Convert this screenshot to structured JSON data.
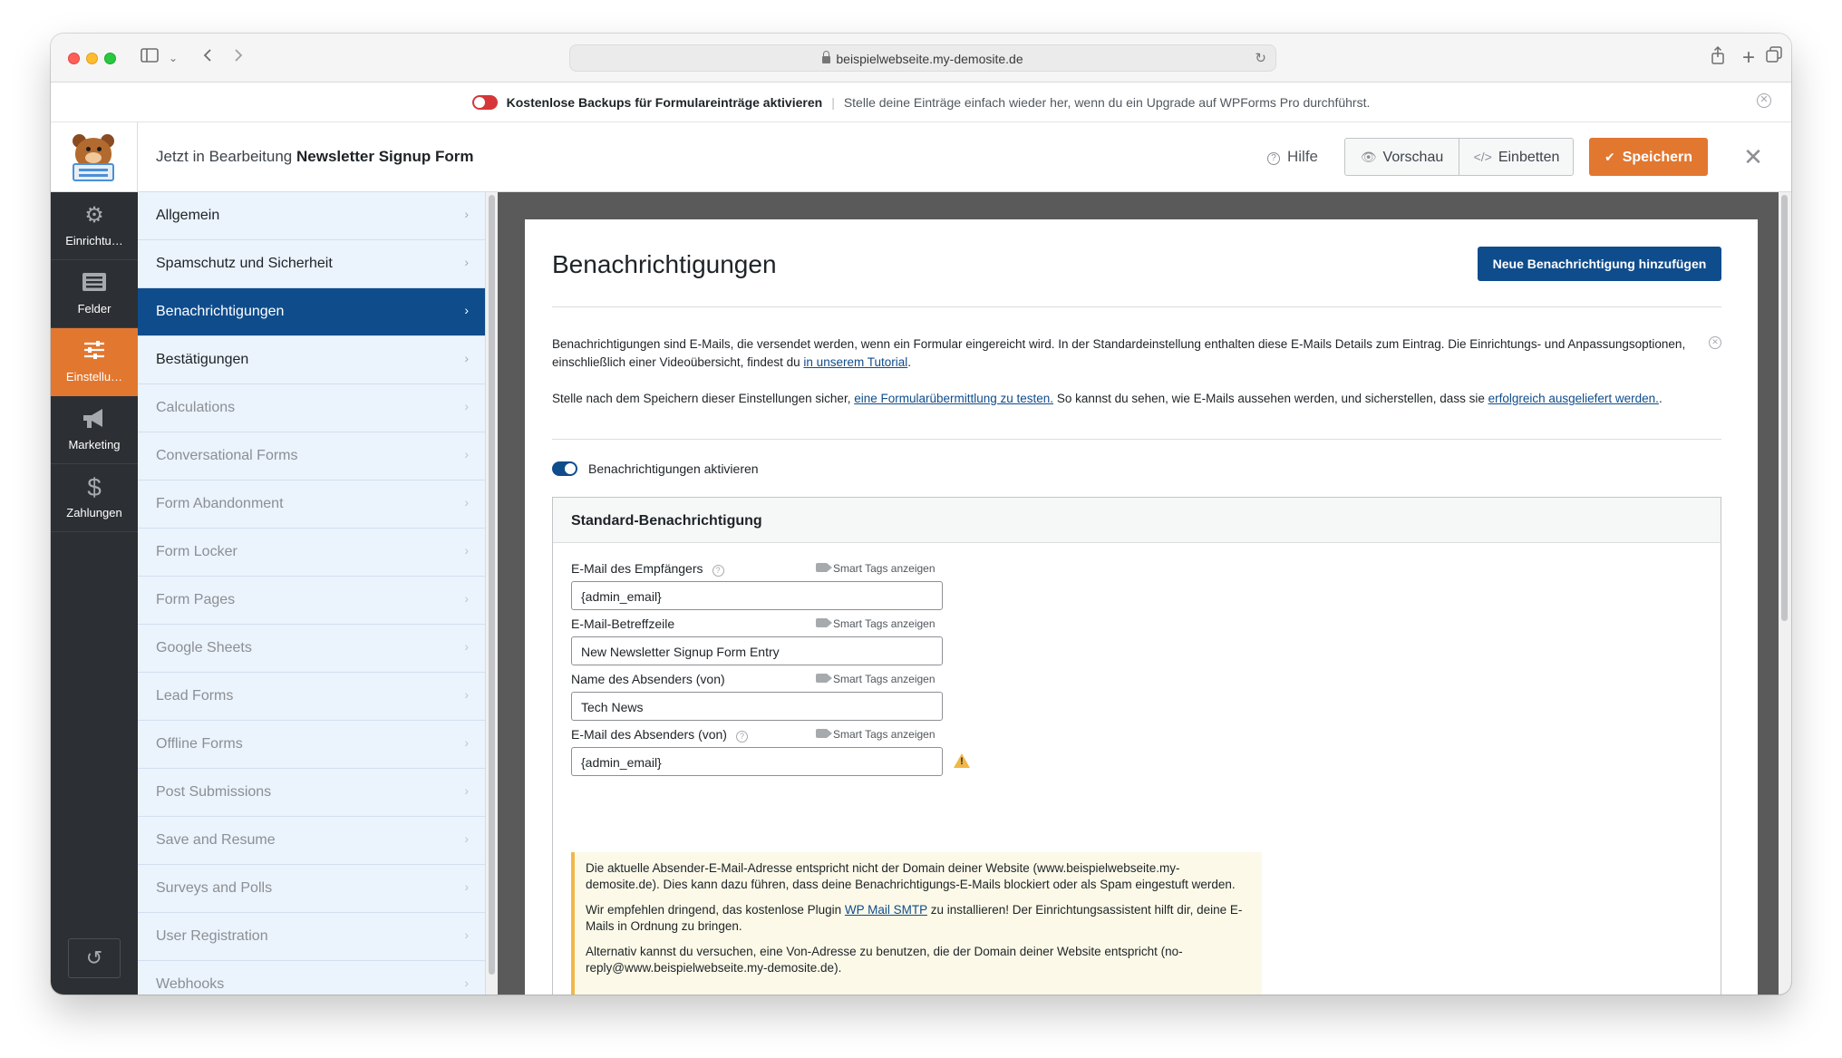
{
  "browser": {
    "url": "beispielwebseite.my-demosite.de"
  },
  "notice": {
    "strong": "Kostenlose Backups für Formulareinträge aktivieren",
    "separator": "|",
    "text": "Stelle deine Einträge einfach wieder her, wenn du ein Upgrade auf WPForms Pro durchführst."
  },
  "header": {
    "editing_prefix": "Jetzt in Bearbeitung",
    "form_name": "Newsletter Signup Form",
    "help_label": "Hilfe",
    "preview_label": "Vorschau",
    "embed_label": "Einbetten",
    "save_label": "Speichern"
  },
  "leftnav": [
    {
      "label": "Einrichtu…",
      "icon": "gear-icon"
    },
    {
      "label": "Felder",
      "icon": "fields-icon"
    },
    {
      "label": "Einstellu…",
      "icon": "sliders-icon",
      "active": true
    },
    {
      "label": "Marketing",
      "icon": "megaphone-icon"
    },
    {
      "label": "Zahlungen",
      "icon": "dollar-icon"
    }
  ],
  "settings_nav": [
    {
      "label": "Allgemein"
    },
    {
      "label": "Spamschutz und Sicherheit"
    },
    {
      "label": "Benachrichtigungen",
      "active": true
    },
    {
      "label": "Bestätigungen"
    },
    {
      "label": "Calculations",
      "disabled": true
    },
    {
      "label": "Conversational Forms",
      "disabled": true
    },
    {
      "label": "Form Abandonment",
      "disabled": true
    },
    {
      "label": "Form Locker",
      "disabled": true
    },
    {
      "label": "Form Pages",
      "disabled": true
    },
    {
      "label": "Google Sheets",
      "disabled": true
    },
    {
      "label": "Lead Forms",
      "disabled": true
    },
    {
      "label": "Offline Forms",
      "disabled": true
    },
    {
      "label": "Post Submissions",
      "disabled": true
    },
    {
      "label": "Save and Resume",
      "disabled": true
    },
    {
      "label": "Surveys and Polls",
      "disabled": true
    },
    {
      "label": "User Registration",
      "disabled": true
    },
    {
      "label": "Webhooks",
      "disabled": true
    }
  ],
  "content": {
    "title": "Benachrichtigungen",
    "add_button": "Neue Benachrichtigung hinzufügen",
    "intro1_a": "Benachrichtigungen sind E-Mails, die versendet werden, wenn ein Formular eingereicht wird. In der Standardeinstellung enthalten diese E-Mails Details zum Eintrag. Die Einrichtungs- und Anpassungsoptionen, einschließlich einer Videoübersicht, findest du ",
    "intro1_link": "in unserem Tutorial",
    "intro1_b": ".",
    "intro2_a": "Stelle nach dem Speichern dieser Einstellungen sicher, ",
    "intro2_link1": "eine Formularübermittlung zu testen.",
    "intro2_b": " So kannst du sehen, wie E-Mails aussehen werden, und sicherstellen, dass sie ",
    "intro2_link2": "erfolgreich ausgeliefert werden.",
    "intro2_c": ".",
    "toggle_label": "Benachrichtigungen aktivieren",
    "box_title": "Standard-Benachrichtigung",
    "smart_tags": "Smart Tags anzeigen",
    "fields": [
      {
        "label": "E-Mail des Empfängers",
        "value": "{admin_email}",
        "help": true
      },
      {
        "label": "E-Mail-Betreffzeile",
        "value": "New Newsletter Signup Form Entry",
        "help": false
      },
      {
        "label": "Name des Absenders (von)",
        "value": "Tech News",
        "help": false
      },
      {
        "label": "E-Mail des Absenders (von)",
        "value": "{admin_email}",
        "help": true
      }
    ],
    "alert": {
      "p1": "Die aktuelle Absender-E-Mail-Adresse entspricht nicht der Domain deiner Website (www.beispielwebseite.my-demosite.de). Dies kann dazu führen, dass deine Benachrichtigungs-E-Mails blockiert oder als Spam eingestuft werden.",
      "p2_a": "Wir empfehlen dringend, das kostenlose Plugin ",
      "p2_link": "WP Mail SMTP",
      "p2_b": " zu installieren! Der Einrichtungsassistent hilft dir, deine E-Mails in Ordnung zu bringen.",
      "p3": "Alternativ kannst du versuchen, eine Von-Adresse zu benutzen, die der Domain deiner Website entspricht (no-reply@www.beispielwebseite.my-demosite.de)."
    }
  }
}
